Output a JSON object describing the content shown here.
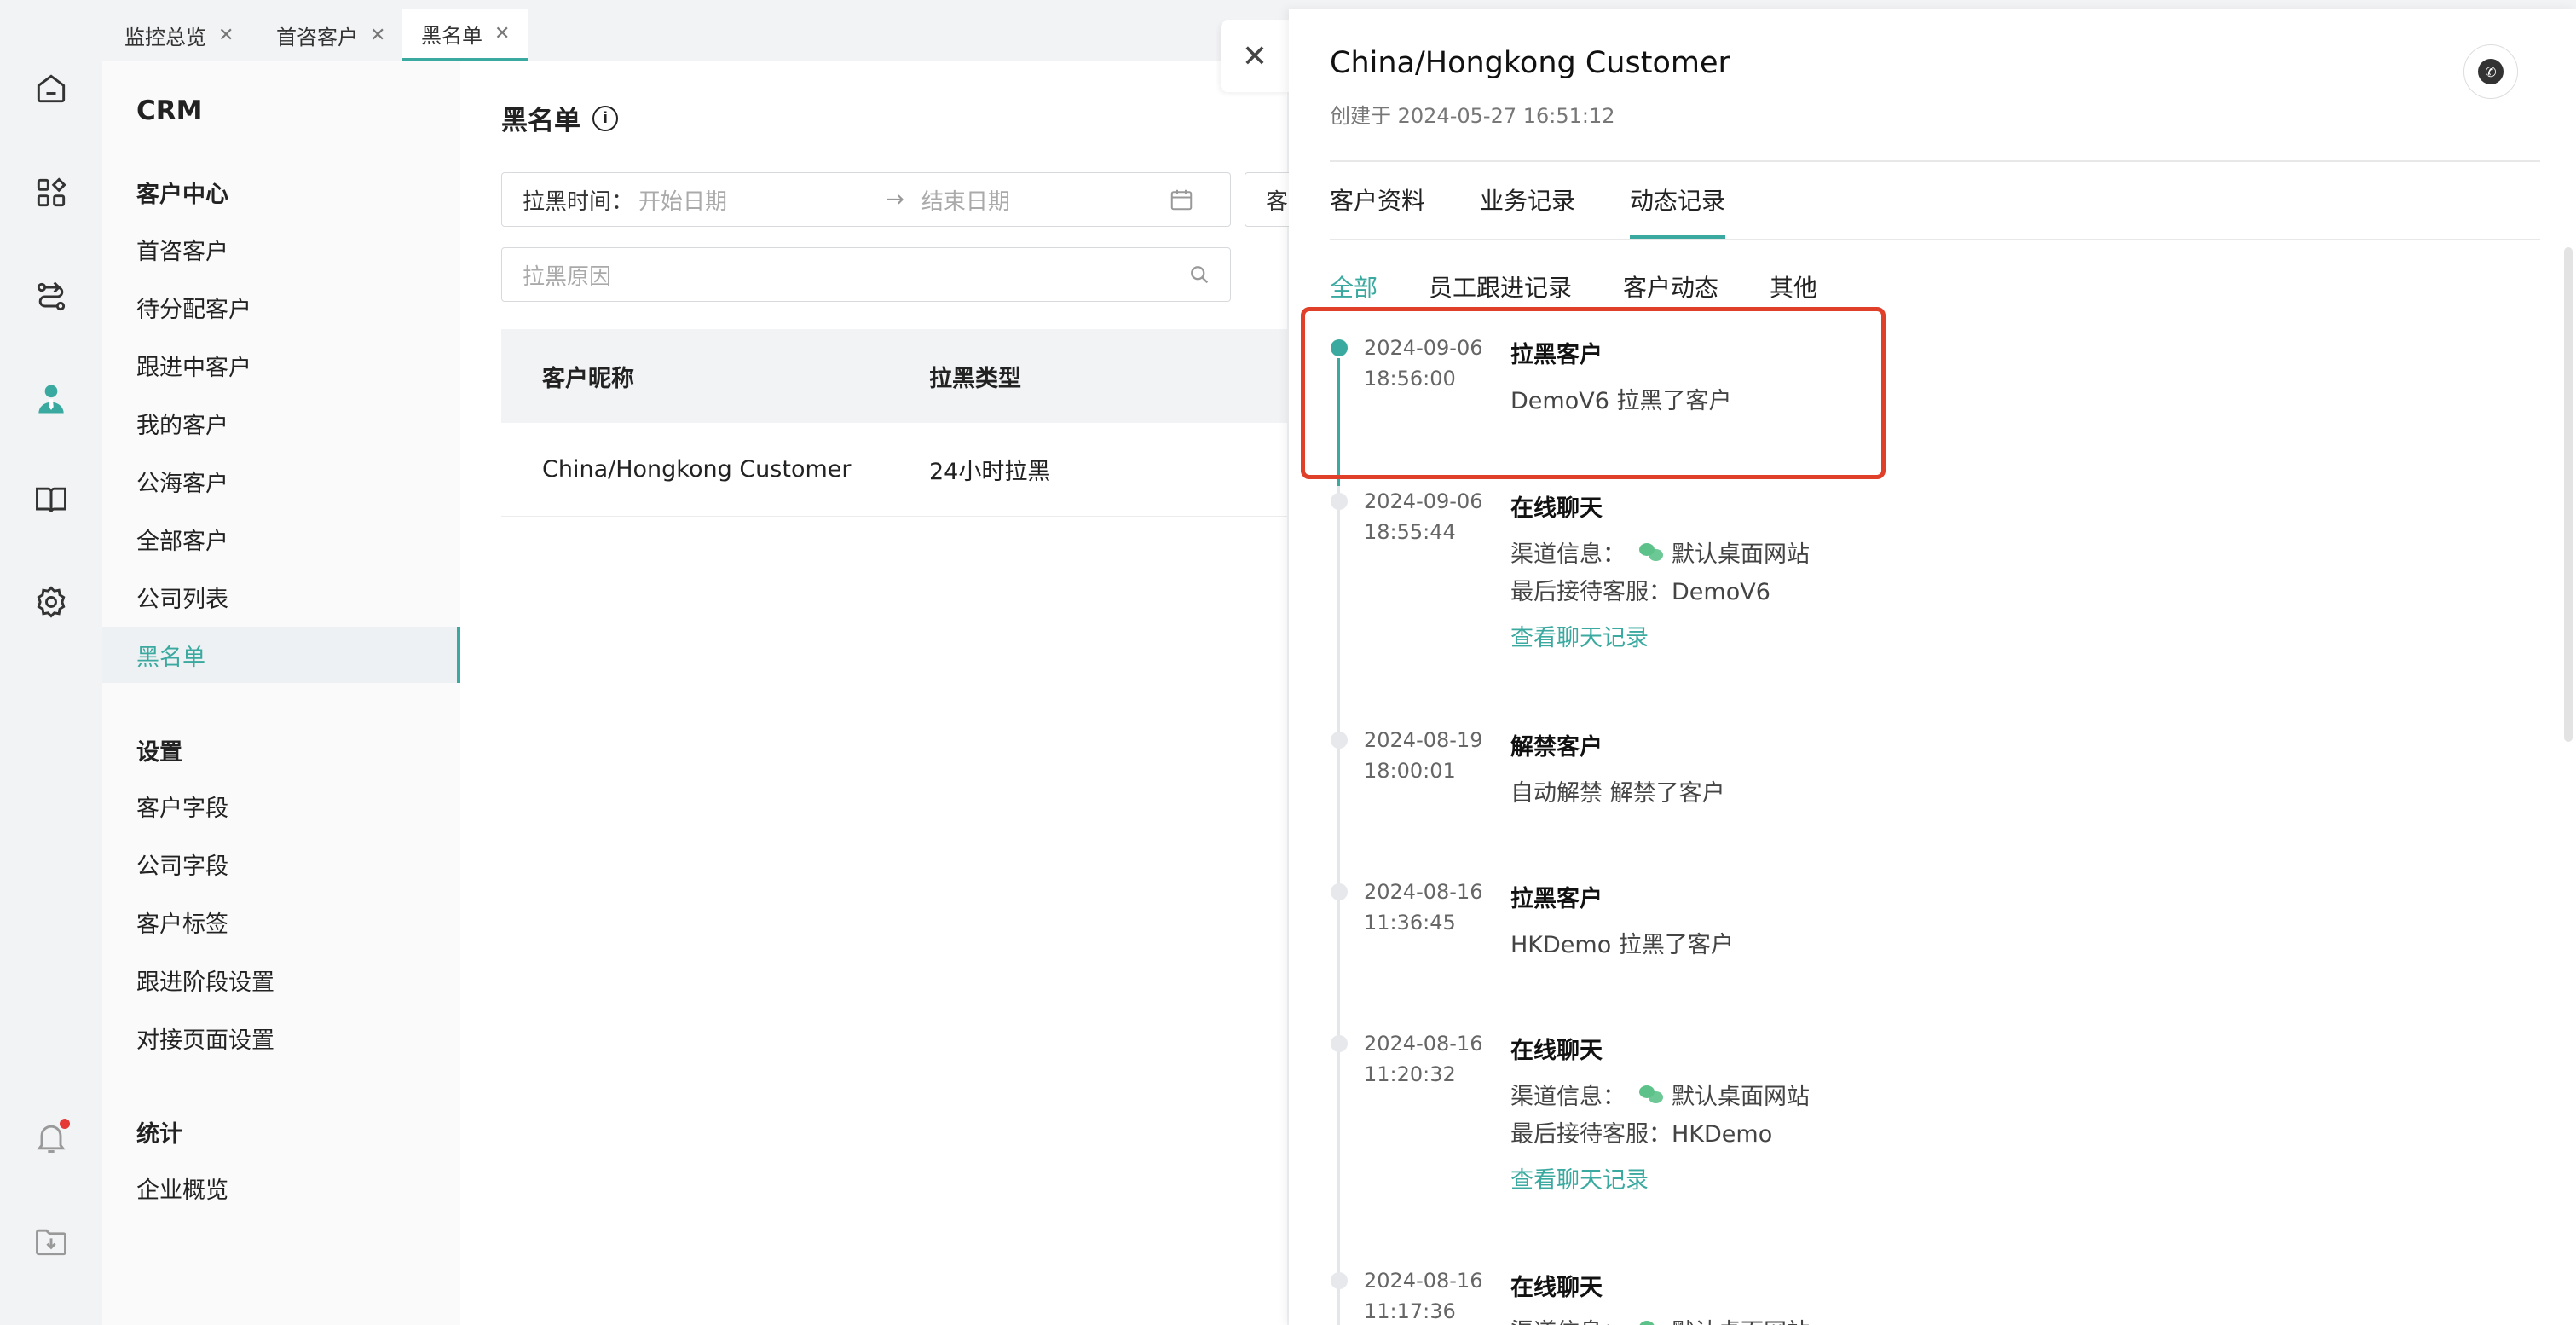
{
  "tabs": [
    {
      "label": "监控总览"
    },
    {
      "label": "首咨客户"
    },
    {
      "label": "黑名单"
    }
  ],
  "subnav": {
    "app_title": "CRM",
    "groups": [
      {
        "label": "客户中心",
        "items": [
          "首咨客户",
          "待分配客户",
          "跟进中客户",
          "我的客户",
          "公海客户",
          "全部客户",
          "公司列表",
          "黑名单"
        ]
      },
      {
        "label": "设置",
        "items": [
          "客户字段",
          "公司字段",
          "客户标签",
          "跟进阶段设置",
          "对接页面设置"
        ]
      },
      {
        "label": "统计",
        "items": [
          "企业概览"
        ]
      }
    ],
    "active_item": "黑名单"
  },
  "main": {
    "title": "黑名单",
    "filter_time_label": "拉黑时间：",
    "start_placeholder": "开始日期",
    "end_placeholder": "结束日期",
    "customer_filter_label": "客",
    "reason_placeholder": "拉黑原因",
    "columns": [
      "客户昵称",
      "拉黑类型"
    ],
    "rows": [
      {
        "name": "China/Hongkong Customer",
        "type": "24小时拉黑"
      }
    ]
  },
  "drawer": {
    "customer_name": "China/Hongkong Customer",
    "created": "创建于 2024-05-27 16:51:12",
    "tabs": [
      "客户资料",
      "业务记录",
      "动态记录"
    ],
    "active_tab": "动态记录",
    "filters": [
      "全部",
      "员工跟进记录",
      "客户动态",
      "其他"
    ],
    "active_filter": "全部",
    "events": [
      {
        "date": "2024-09-06",
        "time": "18:56:00",
        "title": "拉黑客户",
        "desc": "DemoV6 拉黑了客户"
      },
      {
        "date": "2024-09-06",
        "time": "18:55:44",
        "title": "在线聊天",
        "channel_label": "渠道信息：",
        "channel": "默认桌面网站",
        "agent": "最后接待客服：DemoV6",
        "link": "查看聊天记录"
      },
      {
        "date": "2024-08-19",
        "time": "18:00:01",
        "title": "解禁客户",
        "desc": "自动解禁 解禁了客户"
      },
      {
        "date": "2024-08-16",
        "time": "11:36:45",
        "title": "拉黑客户",
        "desc": "HKDemo 拉黑了客户"
      },
      {
        "date": "2024-08-16",
        "time": "11:20:32",
        "title": "在线聊天",
        "channel_label": "渠道信息：",
        "channel": "默认桌面网站",
        "agent": "最后接待客服：HKDemo",
        "link": "查看聊天记录"
      },
      {
        "date": "2024-08-16",
        "time": "11:17:36",
        "title": "在线聊天",
        "channel_label": "渠道信息：",
        "channel": "默认桌面网站"
      }
    ]
  },
  "colors": {
    "accent": "#3aa99f",
    "highlight": "#e0402a",
    "wechat": "#5cc28a"
  }
}
